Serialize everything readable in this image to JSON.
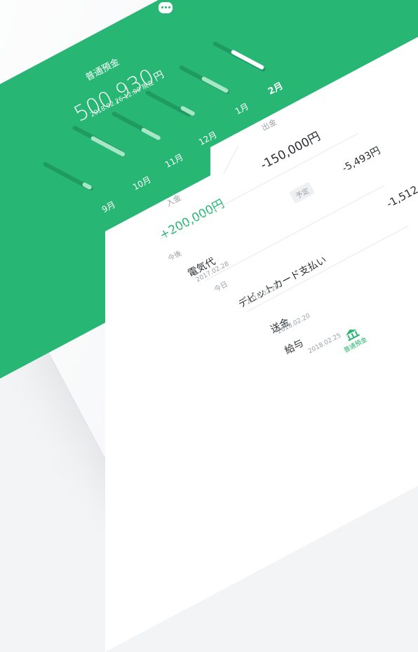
{
  "header": {
    "account_title": "普通預金",
    "balance": "500,930",
    "currency": "円",
    "as_of": "2018.02.26 12:00 現在",
    "chat_icon": "chat-bubble-icon"
  },
  "months": [
    {
      "label": "9月"
    },
    {
      "label": "10月"
    },
    {
      "label": "11月"
    },
    {
      "label": "12月"
    },
    {
      "label": "1月"
    },
    {
      "label": "2月"
    }
  ],
  "summary": {
    "income_label": "入金",
    "income_value": "+200,000円",
    "expense_label": "出金",
    "expense_value": "-150,000円"
  },
  "scheduled_section": {
    "badge": "予定",
    "amount": "-5,493円"
  },
  "sections": {
    "future_label": "今後",
    "today_label": "今日"
  },
  "transactions": [
    {
      "title": "電気代",
      "date": "2017.02.28",
      "amount": ""
    },
    {
      "title": "デビットカード支払い",
      "date": "2018.02.26",
      "amount": "-1,512"
    },
    {
      "title": "送金",
      "date": "2018.02.20",
      "amount": ""
    },
    {
      "title": "給与",
      "date": "2018.02.25",
      "amount": ""
    }
  ],
  "tabbar": {
    "active_label": "普通預金",
    "active_icon": "bank-icon"
  },
  "colors": {
    "accent": "#27b673",
    "accent_dark": "#1f9a60"
  }
}
